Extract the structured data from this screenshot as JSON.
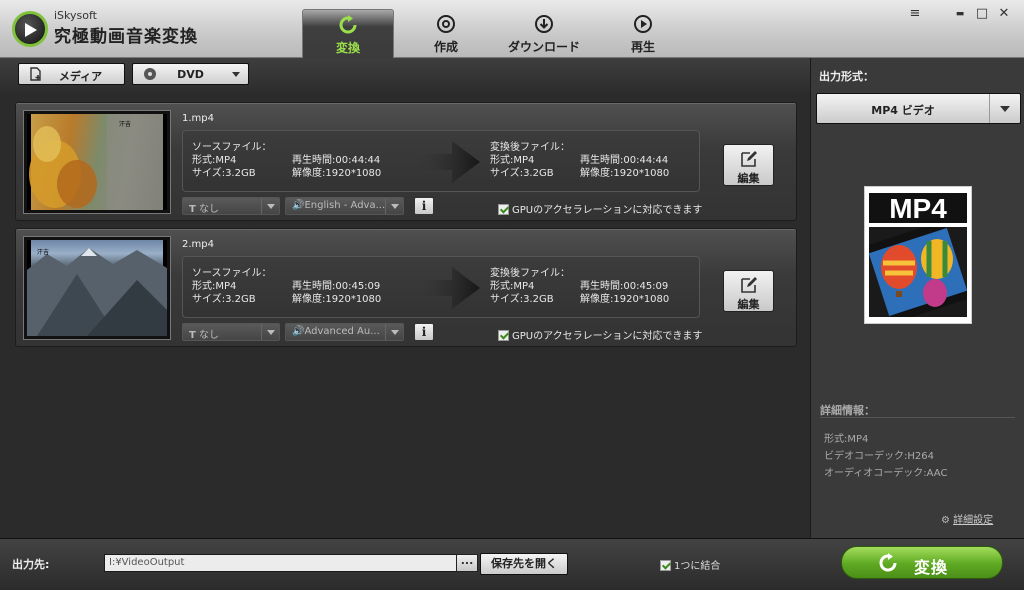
{
  "app": {
    "brand_small": "iSkysoft",
    "brand_title": "究極動画音楽変換",
    "accent": "#7fc23a"
  },
  "nav": {
    "tabs": [
      {
        "label": "変換",
        "icon": "refresh-icon",
        "active": true
      },
      {
        "label": "作成",
        "icon": "disc-icon",
        "active": false
      },
      {
        "label": "ダウンロード",
        "icon": "download-icon",
        "active": false
      },
      {
        "label": "再生",
        "icon": "play-icon",
        "active": false
      }
    ]
  },
  "window_controls": {
    "menu": "≡",
    "minimize": "▬",
    "maximize": "□",
    "close": "✕"
  },
  "toolbar": {
    "media_label": "メディア",
    "dvd_label": "DVD"
  },
  "items": [
    {
      "filename": "1.mp4",
      "source_header": "ソースファイル：",
      "source_format": "形式:MP4",
      "source_duration": "再生時間:00:44:44",
      "source_size": "サイズ:3.2GB",
      "source_resolution": "解像度:1920*1080",
      "target_header": "変換後ファイル：",
      "target_format": "形式:MP4",
      "target_duration": "再生時間:00:44:44",
      "target_size": "サイズ:3.2GB",
      "target_resolution": "解像度:1920*1080",
      "edit_label": "編集",
      "subtitle_select": "なし",
      "audio_select": "English - Adva...",
      "gpu_label": "GPUのアクセラレーションに対応できます",
      "gpu_checked": true
    },
    {
      "filename": "2.mp4",
      "source_header": "ソースファイル：",
      "source_format": "形式:MP4",
      "source_duration": "再生時間:00:45:09",
      "source_size": "サイズ:3.2GB",
      "source_resolution": "解像度:1920*1080",
      "target_header": "変換後ファイル：",
      "target_format": "形式:MP4",
      "target_duration": "再生時間:00:45:09",
      "target_size": "サイズ:3.2GB",
      "target_resolution": "解像度:1920*1080",
      "edit_label": "編集",
      "subtitle_select": "なし",
      "audio_select": "Advanced Au...",
      "gpu_label": "GPUのアクセラレーションに対応できます",
      "gpu_checked": true
    }
  ],
  "right_panel": {
    "title": "出力形式：",
    "format_selected": "MP4 ビデオ",
    "format_icon_text": "MP4",
    "details_header": "詳細情報：",
    "details": [
      "形式:MP4",
      "ビデオコーデック:H264",
      "オーディオコーデック:AAC"
    ],
    "advanced_settings": "詳細設定"
  },
  "bottom": {
    "output_label": "出力先:",
    "output_path": "I:¥VideoOutput",
    "browse_label": "...",
    "open_folder_label": "保存先を開く",
    "merge_label": "1つに結合",
    "merge_checked": true,
    "convert_label": "変換"
  }
}
